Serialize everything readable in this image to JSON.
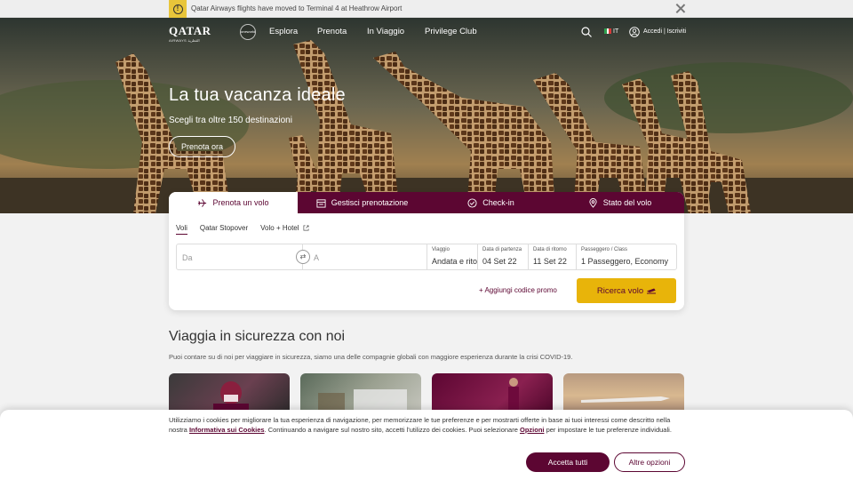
{
  "notice": {
    "text": "Qatar Airways flights have moved to Terminal 4 at Heathrow Airport"
  },
  "header": {
    "logo_text": "QATAR",
    "logo_sub": "AIRWAYS القطرية",
    "oneworld": "oneworld",
    "nav": [
      "Esplora",
      "Prenota",
      "In Viaggio",
      "Privilege Club"
    ],
    "lang": "IT",
    "login": "Accedi | Iscriviti"
  },
  "hero": {
    "title": "La tua vacanza ideale",
    "subtitle": "Scegli tra oltre 150 destinazioni",
    "button": "Prenota ora"
  },
  "booking": {
    "tabs": [
      {
        "label": "Prenota un volo",
        "icon": "plane-icon",
        "active": true
      },
      {
        "label": "Gestisci prenotazione",
        "icon": "calendar-icon",
        "active": false
      },
      {
        "label": "Check-in",
        "icon": "check-circle-icon",
        "active": false
      },
      {
        "label": "Stato del volo",
        "icon": "location-pin-icon",
        "active": false
      }
    ],
    "subtabs": [
      "Voli",
      "Qatar Stopover",
      "Volo + Hotel"
    ],
    "from_placeholder": "Da",
    "to_placeholder": "A",
    "trip_label": "Viaggio",
    "trip_value": "Andata e rito",
    "depart_label": "Data di partenza",
    "depart_value": "04 Set 22",
    "return_label": "Data di ritorno",
    "return_value": "11 Set 22",
    "pax_label": "Passeggero / Class",
    "pax_value": "1 Passeggero, Economy",
    "promo": "+ Aggiungi codice promo",
    "search": "Ricerca volo"
  },
  "safety": {
    "title": "Viaggia in sicurezza con noi",
    "text": "Puoi contare su di noi per viaggiare in sicurezza, siamo una delle compagnie globali con maggiore esperienza durante la crisi COVID-19."
  },
  "cookie": {
    "text_1": "Utilizziamo i cookies per migliorare la tua esperienza di navigazione, per memorizzare le tue preferenze e per mostrarti offerte in base ai tuoi interessi come descritto nella nostra ",
    "link_1": "Informativa sui Cookies",
    "text_2": ". Continuando a navigare sul nostro sito, accetti l'utilizzo dei cookies. Puoi selezionare ",
    "link_2": "Opzioni",
    "text_3": " per impostare le tue preferenze individuali.",
    "accept": "Accetta tutti",
    "options": "Altre opzioni"
  },
  "colors": {
    "brand": "#5c0632",
    "accent": "#e8b40a"
  }
}
